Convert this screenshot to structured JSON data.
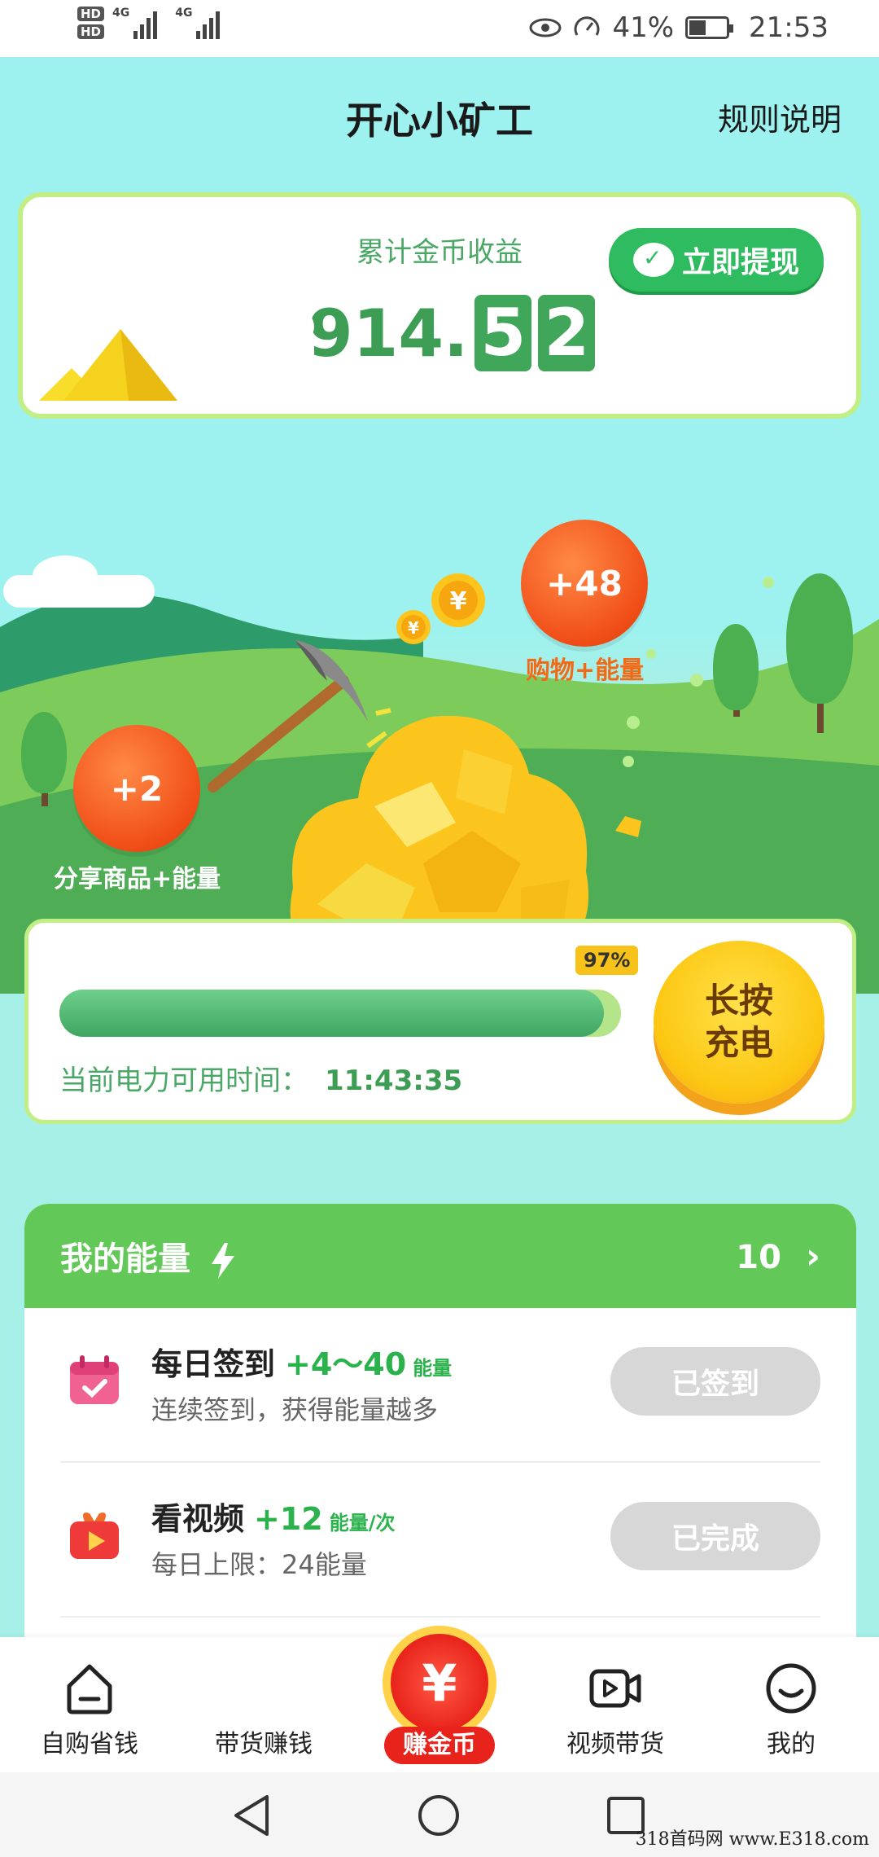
{
  "status_bar": {
    "hd1": "HD",
    "hd2": "HD",
    "net1": "4G",
    "net2": "4G",
    "battery_pct": "41%",
    "time": "21:53"
  },
  "header": {
    "title": "开心小矿工",
    "rules": "规则说明"
  },
  "earnings": {
    "label": "累计金币收益",
    "amount_whole": "914.",
    "digit1": "5",
    "digit2": "2",
    "withdraw": "立即提现"
  },
  "bubbles": {
    "shopping_value": "+48",
    "shopping_label": "购物+能量",
    "share_value": "+2",
    "share_label": "分享商品+能量"
  },
  "power": {
    "percent_label": "97%",
    "percent": 0.97,
    "time_label": "当前电力可用时间：",
    "time_value": "11:43:35",
    "charge_button": "长按充电"
  },
  "my_energy": {
    "title": "我的能量",
    "count": "10",
    "chevron": "›",
    "tasks": [
      {
        "title": "每日签到",
        "reward": "+4～40",
        "unit": "能量",
        "subtitle": "连续签到，获得能量越多",
        "button": "已签到",
        "icon": "calendar-icon"
      },
      {
        "title": "看视频",
        "reward": "+12",
        "unit": "能量/次",
        "subtitle": "每日上限：24能量",
        "button": "已完成",
        "icon": "video-gift-icon"
      }
    ]
  },
  "tabbar": {
    "tab1": "自购省钱",
    "tab2": "带货赚钱",
    "center_symbol": "¥",
    "center": "赚金币",
    "tab4": "视频带货",
    "tab5": "我的"
  },
  "watermark": "318首码网 www.E318.com"
}
